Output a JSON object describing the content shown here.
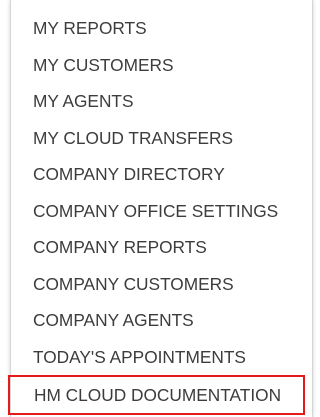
{
  "menu": {
    "items": [
      {
        "label": "MY REPORTS"
      },
      {
        "label": "MY CUSTOMERS"
      },
      {
        "label": "MY AGENTS"
      },
      {
        "label": "MY CLOUD TRANSFERS"
      },
      {
        "label": "COMPANY DIRECTORY"
      },
      {
        "label": "COMPANY OFFICE SETTINGS"
      },
      {
        "label": "COMPANY REPORTS"
      },
      {
        "label": "COMPANY CUSTOMERS"
      },
      {
        "label": "COMPANY AGENTS"
      },
      {
        "label": "TODAY'S APPOINTMENTS"
      },
      {
        "label": "HM CLOUD DOCUMENTATION"
      }
    ],
    "highlight_color": "#e51a1a",
    "text_color": "#3c3c3c"
  }
}
